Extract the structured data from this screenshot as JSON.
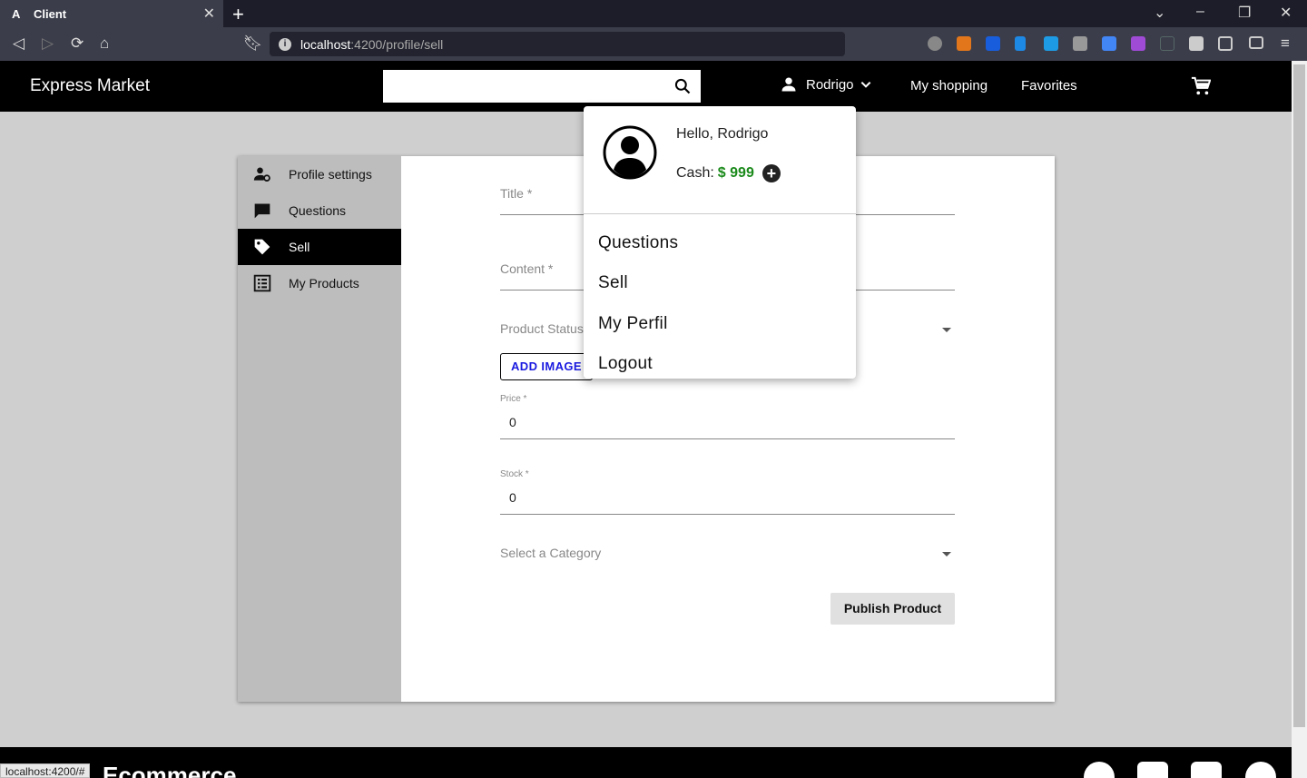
{
  "browser": {
    "tab_title": "Client",
    "favicon": "A",
    "url_host": "localhost",
    "url_path": ":4200/profile/sell",
    "status_url": "localhost:4200/#"
  },
  "header": {
    "brand": "Express Market",
    "search_value": "",
    "user_name": "Rodrigo",
    "nav": [
      "My shopping",
      "Favorites"
    ]
  },
  "sidenav": {
    "items": [
      {
        "label": "Profile settings",
        "icon": "user-gear-icon"
      },
      {
        "label": "Questions",
        "icon": "chat-icon"
      },
      {
        "label": "Sell",
        "icon": "tag-icon",
        "active": true
      },
      {
        "label": "My Products",
        "icon": "list-icon"
      }
    ]
  },
  "form": {
    "title_label": "Title *",
    "content_label": "Content *",
    "status_label": "Product Status",
    "add_image": "ADD IMAGE",
    "price_label": "Price *",
    "price_value": "0",
    "stock_label": "Stock *",
    "stock_value": "0",
    "category_label": "Select a Category",
    "publish": "Publish Product"
  },
  "usermenu": {
    "hello": "Hello, Rodrigo",
    "cash_label": "Cash:",
    "cash_amount": "$ 999",
    "items": [
      "Questions",
      "Sell",
      "My Perfil",
      "Logout"
    ]
  },
  "footer": {
    "title": "Ecommerce"
  },
  "colors": {
    "accent_green": "#1b8a1b",
    "header_bg": "#000000",
    "add_image_blue": "#1a1ae0"
  }
}
